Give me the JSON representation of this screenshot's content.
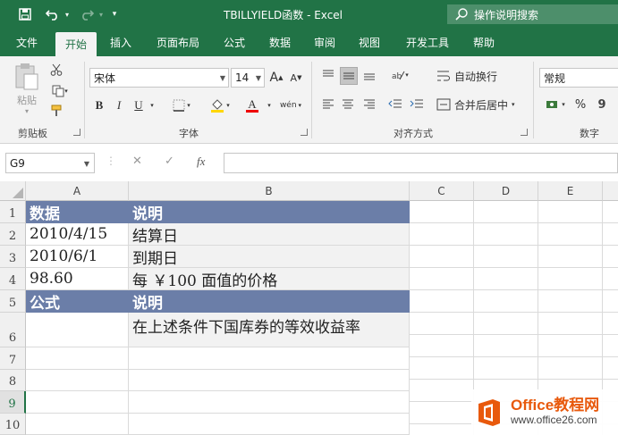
{
  "window": {
    "title": "TBILLYIELD函数 - Excel"
  },
  "search": {
    "placeholder": "操作说明搜索"
  },
  "tabs": [
    {
      "label": "文件"
    },
    {
      "label": "开始"
    },
    {
      "label": "插入"
    },
    {
      "label": "页面布局"
    },
    {
      "label": "公式"
    },
    {
      "label": "数据"
    },
    {
      "label": "审阅"
    },
    {
      "label": "视图"
    },
    {
      "label": "开发工具"
    },
    {
      "label": "帮助"
    }
  ],
  "ribbon": {
    "clipboard": {
      "paste": "粘贴",
      "label": "剪贴板"
    },
    "font": {
      "name": "宋体",
      "size": "14",
      "label": "字体",
      "bold": "B",
      "italic": "I",
      "underline": "U",
      "font_color_glyph": "A",
      "wen_glyph": "wén",
      "grow": "A",
      "shrink": "A"
    },
    "alignment": {
      "wrap": "自动换行",
      "merge": "合并后居中",
      "label": "对齐方式"
    },
    "number": {
      "format": "常规",
      "label": "数字",
      "percent": "%",
      "comma": "9"
    }
  },
  "formula_bar": {
    "name_box": "G9",
    "fx": "fx",
    "value": ""
  },
  "columns": [
    "A",
    "B",
    "C",
    "D",
    "E"
  ],
  "rows": [
    "1",
    "2",
    "3",
    "4",
    "5",
    "6",
    "7",
    "8",
    "9",
    "10"
  ],
  "sheet": {
    "r1": {
      "a": "数据",
      "b": "说明"
    },
    "r2": {
      "a": "2010/4/15",
      "b": "结算日"
    },
    "r3": {
      "a": "2010/6/1",
      "b": "到期日"
    },
    "r4": {
      "a": "98.60",
      "b": "每 ￥100 面值的价格"
    },
    "r5": {
      "a": "公式",
      "b": "说明"
    },
    "r6": {
      "a": "",
      "b": "在上述条件下国库券的等效收益率"
    }
  },
  "watermark": {
    "line1": "Office教程网",
    "line2": "www.office26.com"
  },
  "colors": {
    "excel_green": "#217346",
    "header_fill": "#6b7ea8",
    "watermark_orange": "#e8590c"
  }
}
